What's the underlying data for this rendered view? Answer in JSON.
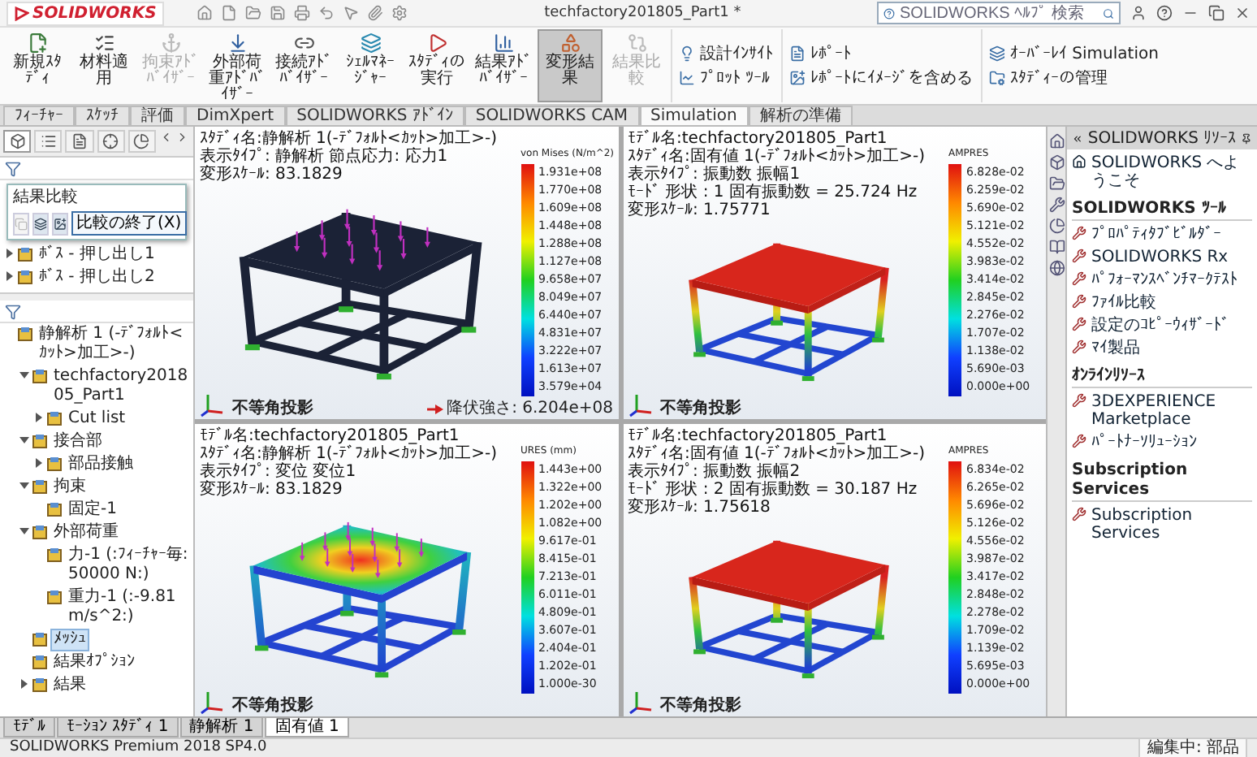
{
  "title_bar": {
    "logo": "SOLIDWORKS",
    "title": "techfactory201805_Part1 *",
    "search": {
      "placeholder": "SOLIDWORKS ﾍﾙﾌﾟ 検索"
    }
  },
  "ribbon": {
    "tools": [
      {
        "label": "新規ｽﾀﾃﾞｨ",
        "selected": false,
        "disabled": false
      },
      {
        "label": "材料適用",
        "selected": false,
        "disabled": false
      },
      {
        "label": "拘束ｱﾄﾞﾊﾞｲｻﾞｰ",
        "selected": false,
        "disabled": true
      },
      {
        "label": "外部荷重ｱﾄﾞﾊﾞｲｻﾞｰ",
        "selected": false,
        "disabled": false
      },
      {
        "label": "接続ｱﾄﾞﾊﾞｲｻﾞｰ",
        "selected": false,
        "disabled": false
      },
      {
        "label": "ｼｪﾙﾏﾈｰｼﾞｬｰ",
        "selected": false,
        "disabled": false
      },
      {
        "label": "ｽﾀﾃﾞｨの実行",
        "selected": false,
        "disabled": false
      },
      {
        "label": "結果ｱﾄﾞﾊﾞｲｻﾞｰ",
        "selected": false,
        "disabled": false
      },
      {
        "label": "変形結果",
        "selected": true,
        "disabled": false
      },
      {
        "label": "結果比較",
        "selected": false,
        "disabled": true
      }
    ],
    "small_groups": [
      [
        "設計ｲﾝｻｲﾄ",
        "ﾌﾟﾛｯﾄ ﾂｰﾙ"
      ],
      [
        "ﾚﾎﾟｰﾄ",
        "ﾚﾎﾟｰﾄにｲﾒｰｼﾞを含める"
      ],
      [
        "ｵｰﾊﾞｰﾚｲ Simulation",
        "ｽﾀﾃﾞｨｰの管理"
      ]
    ]
  },
  "command_tabs": [
    {
      "label": "ﾌｨｰﾁｬｰ",
      "selected": false
    },
    {
      "label": "ｽｹｯﾁ",
      "selected": false
    },
    {
      "label": "評価",
      "selected": false
    },
    {
      "label": "DimXpert",
      "selected": false
    },
    {
      "label": "SOLIDWORKS ｱﾄﾞｲﾝ",
      "selected": false
    },
    {
      "label": "SOLIDWORKS CAM",
      "selected": false
    },
    {
      "label": "Simulation",
      "selected": true
    },
    {
      "label": "解析の準備",
      "selected": false
    }
  ],
  "feature_panel": {
    "tabs": [
      {
        "selected": true
      },
      {
        "selected": false
      },
      {
        "selected": false
      },
      {
        "selected": false
      },
      {
        "selected": false
      }
    ],
    "compare_popup": {
      "title": "結果比較",
      "button": "比較の終了(X)"
    },
    "items": [
      {
        "label": "ﾎﾞｽ - 押し出し1",
        "expanded": false
      },
      {
        "label": "ﾎﾞｽ - 押し出し2",
        "expanded": false
      }
    ]
  },
  "study_tree": {
    "label": "静解析 1 (-ﾃﾞﾌｫﾙﾄ<ｶｯﾄ>加工>-)",
    "selected": false,
    "children": [
      {
        "label": "techfactory201805_Part1",
        "expanded": true,
        "selected": false,
        "children": [
          {
            "label": "Cut list",
            "expanded": false,
            "selected": false
          }
        ]
      },
      {
        "label": "接合部",
        "expanded": true,
        "selected": false,
        "children": [
          {
            "label": "部品接触",
            "expanded": false,
            "selected": false
          }
        ]
      },
      {
        "label": "拘束",
        "expanded": true,
        "selected": false,
        "children": [
          {
            "label": "固定-1",
            "selected": false
          }
        ]
      },
      {
        "label": "外部荷重",
        "expanded": true,
        "selected": false,
        "children": [
          {
            "label": "力-1 (:ﾌｨｰﾁｬｰ毎: 50000 N:)",
            "selected": false
          },
          {
            "label": "重力-1 (:-9.81 m/s^2:)",
            "selected": false
          }
        ]
      },
      {
        "label": "ﾒｯｼｭ",
        "selected": true
      },
      {
        "label": "結果ｵﾌﾟｼｮﾝ",
        "selected": false
      },
      {
        "label": "結果",
        "expanded": false,
        "selected": false
      }
    ]
  },
  "viewports": [
    {
      "kind": "stress",
      "header_lines": [
        "ｽﾀﾃﾞｨ名:静解析 1(-ﾃﾞﾌｫﾙﾄ<ｶｯﾄ>加工>-)",
        "表示ﾀｲﾌﾟ: 静解析 節点応力: 応力1",
        "変形ｽｹｰﾙ: 83.1829"
      ],
      "legend": {
        "title": "von Mises (N/m^2)",
        "labels": [
          "1.931e+08",
          "1.770e+08",
          "1.609e+08",
          "1.448e+08",
          "1.288e+08",
          "1.127e+08",
          "9.658e+07",
          "8.049e+07",
          "6.440e+07",
          "4.831e+07",
          "3.222e+07",
          "1.613e+07",
          "3.579e+04"
        ]
      },
      "note": "降伏強さ: 6.204e+08",
      "footer": "不等角投影"
    },
    {
      "kind": "mode",
      "header_lines": [
        "ﾓﾃﾞﾙ名:techfactory201805_Part1",
        "ｽﾀﾃﾞｨ名:固有値 1(-ﾃﾞﾌｫﾙﾄ<ｶｯﾄ>加工>-)",
        "表示ﾀｲﾌﾟ: 振動数 振幅1",
        "ﾓｰﾄﾞ 形状 : 1 固有振動数 = 25.724 Hz",
        "変形ｽｹｰﾙ: 1.75771"
      ],
      "legend": {
        "title": "AMPRES",
        "labels": [
          "6.828e-02",
          "6.259e-02",
          "5.690e-02",
          "5.121e-02",
          "4.552e-02",
          "3.983e-02",
          "3.414e-02",
          "2.845e-02",
          "2.276e-02",
          "1.707e-02",
          "1.138e-02",
          "5.690e-03",
          "0.000e+00"
        ]
      },
      "footer": "不等角投影"
    },
    {
      "kind": "displacement",
      "header_lines": [
        "ﾓﾃﾞﾙ名:techfactory201805_Part1",
        "ｽﾀﾃﾞｨ名:静解析 1(-ﾃﾞﾌｫﾙﾄ<ｶｯﾄ>加工>-)",
        "表示ﾀｲﾌﾟ: 変位 変位1",
        "変形ｽｹｰﾙ: 83.1829"
      ],
      "legend": {
        "title": "URES (mm)",
        "labels": [
          "1.443e+00",
          "1.322e+00",
          "1.202e+00",
          "1.082e+00",
          "9.617e-01",
          "8.415e-01",
          "7.213e-01",
          "6.011e-01",
          "4.809e-01",
          "3.607e-01",
          "2.404e-01",
          "1.202e-01",
          "1.000e-30"
        ]
      },
      "footer": "不等角投影"
    },
    {
      "kind": "mode",
      "header_lines": [
        "ﾓﾃﾞﾙ名:techfactory201805_Part1",
        "ｽﾀﾃﾞｨ名:固有値 1(-ﾃﾞﾌｫﾙﾄ<ｶｯﾄ>加工>-)",
        "表示ﾀｲﾌﾟ: 振動数 振幅2",
        "ﾓｰﾄﾞ 形状 : 2 固有振動数 = 30.187 Hz",
        "変形ｽｹｰﾙ: 1.75618"
      ],
      "legend": {
        "title": "AMPRES",
        "labels": [
          "6.834e-02",
          "6.265e-02",
          "5.696e-02",
          "5.126e-02",
          "4.556e-02",
          "3.987e-02",
          "3.417e-02",
          "2.848e-02",
          "2.278e-02",
          "1.709e-02",
          "1.139e-02",
          "5.695e-03",
          "0.000e+00"
        ]
      },
      "footer": "不等角投影"
    }
  ],
  "task_pane": {
    "title": "SOLIDWORKS ﾘｿｰｽ",
    "welcome": "SOLIDWORKS へようこそ",
    "sections": [
      {
        "heading": "SOLIDWORKS ﾂｰﾙ",
        "items": [
          "ﾌﾟﾛﾊﾟﾃｨﾀﾌﾞﾋﾞﾙﾀﾞｰ",
          "SOLIDWORKS Rx",
          "ﾊﾟﾌｫｰﾏﾝｽﾍﾞﾝﾁﾏｰｸﾃｽﾄ",
          "ﾌｧｲﾙ比較",
          "設定のｺﾋﾟｰｳｨｻﾞｰﾄﾞ",
          "ﾏｲ製品"
        ]
      },
      {
        "heading": "ｵﾝﾗｲﾝﾘｿｰｽ",
        "items": [
          "3DEXPERIENCE Marketplace",
          "ﾊﾟｰﾄﾅｰｿﾘｭｰｼｮﾝ"
        ]
      },
      {
        "heading": "Subscription Services",
        "items": [
          "Subscription Services"
        ]
      }
    ]
  },
  "bottom_tabs": [
    {
      "label": "ﾓﾃﾞﾙ",
      "selected": false
    },
    {
      "label": "ﾓｰｼｮﾝ ｽﾀﾃﾞｨ 1",
      "selected": false
    },
    {
      "label": "静解析 1",
      "selected": false
    },
    {
      "label": "固有値 1",
      "selected": true
    }
  ],
  "status_bar": {
    "product": "SOLIDWORKS Premium 2018 SP4.0",
    "mode": "編集中: 部品"
  }
}
